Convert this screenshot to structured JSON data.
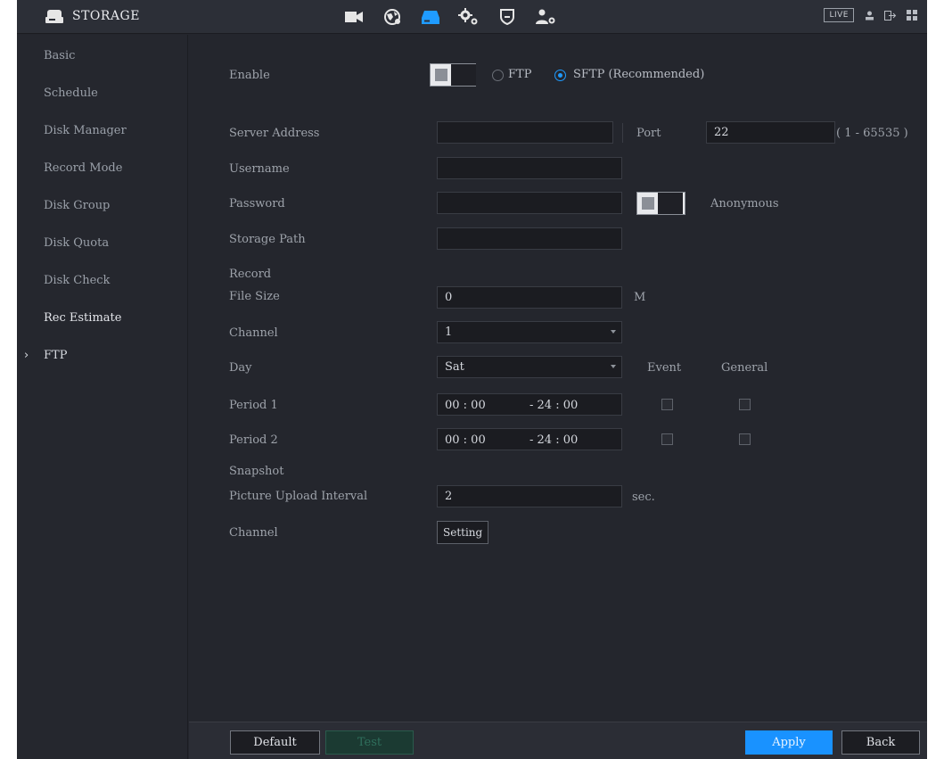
{
  "header": {
    "title": "STORAGE",
    "live_label": "LIVE",
    "modules": [
      {
        "name": "camera",
        "icon": "video-camera-icon",
        "active": false
      },
      {
        "name": "network",
        "icon": "globe-network-icon",
        "active": false
      },
      {
        "name": "storage",
        "icon": "storage-drive-icon",
        "active": true
      },
      {
        "name": "system",
        "icon": "gears-icon",
        "active": false
      },
      {
        "name": "security",
        "icon": "shield-icon",
        "active": false
      },
      {
        "name": "account",
        "icon": "user-settings-icon",
        "active": false
      }
    ],
    "right_icons": [
      "user-icon",
      "logout-icon",
      "grid-menu-icon"
    ],
    "accent_color": "#1f9bff"
  },
  "sidebar": {
    "items": [
      {
        "label": "Basic"
      },
      {
        "label": "Schedule"
      },
      {
        "label": "Disk Manager"
      },
      {
        "label": "Record Mode"
      },
      {
        "label": "Disk Group"
      },
      {
        "label": "Disk Quota"
      },
      {
        "label": "Disk Check"
      },
      {
        "label": "Rec Estimate"
      },
      {
        "label": "FTP",
        "active": true
      }
    ]
  },
  "form": {
    "enable": {
      "label": "Enable",
      "checked": false
    },
    "protocol": {
      "ftp_label": "FTP",
      "sftp_label": "SFTP (Recommended)",
      "selected": "SFTP (Recommended)"
    },
    "server_address": {
      "label": "Server Address",
      "value": ""
    },
    "port": {
      "label": "Port",
      "value": "22",
      "range": "( 1 - 65535 )"
    },
    "username": {
      "label": "Username",
      "value": ""
    },
    "password": {
      "label": "Password",
      "value": "",
      "anonymous_label": "Anonymous"
    },
    "storage_path": {
      "label": "Storage Path",
      "value": ""
    },
    "record": {
      "section_label": "Record",
      "file_size": {
        "label": "File Size",
        "value": "0",
        "unit": "M"
      },
      "channel": {
        "label": "Channel",
        "value": "1"
      },
      "day": {
        "label": "Day",
        "value": "Sat"
      },
      "event_label": "Event",
      "general_label": "General",
      "periods": [
        {
          "label": "Period 1",
          "start": "00 : 00",
          "end": "- 24 : 00",
          "event": false,
          "general": false
        },
        {
          "label": "Period 2",
          "start": "00 : 00",
          "end": "- 24 : 00",
          "event": false,
          "general": false
        }
      ]
    },
    "snapshot": {
      "section_label": "Snapshot",
      "upload_interval": {
        "label": "Picture Upload Interval",
        "value": "2",
        "unit": "sec."
      },
      "channel": {
        "label": "Channel",
        "button_label": "Setting"
      }
    }
  },
  "footer": {
    "default_label": "Default",
    "test_label": "Test",
    "apply_label": "Apply",
    "back_label": "Back"
  }
}
